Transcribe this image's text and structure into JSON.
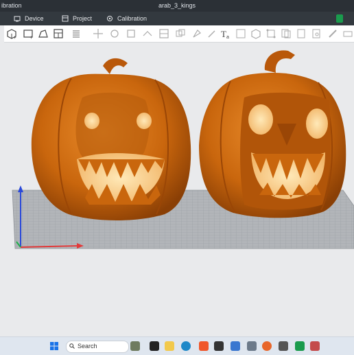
{
  "window": {
    "app_title": "ibration",
    "project_name": "arab_3_kings"
  },
  "tabs": [
    {
      "label": "Device",
      "icon": "device-icon"
    },
    {
      "label": "Project",
      "icon": "project-icon"
    },
    {
      "label": "Calibration",
      "icon": "calibration-icon"
    }
  ],
  "taskbar": {
    "search_label": "Search"
  },
  "colors": {
    "titlebar": "#2b3036",
    "tabbar": "#33393f",
    "pumpkin": "#c9660d",
    "plate": "#b4b7bb",
    "axis_x": "#e23a3a",
    "axis_y": "#1fb04a",
    "axis_z": "#2a49d9"
  }
}
